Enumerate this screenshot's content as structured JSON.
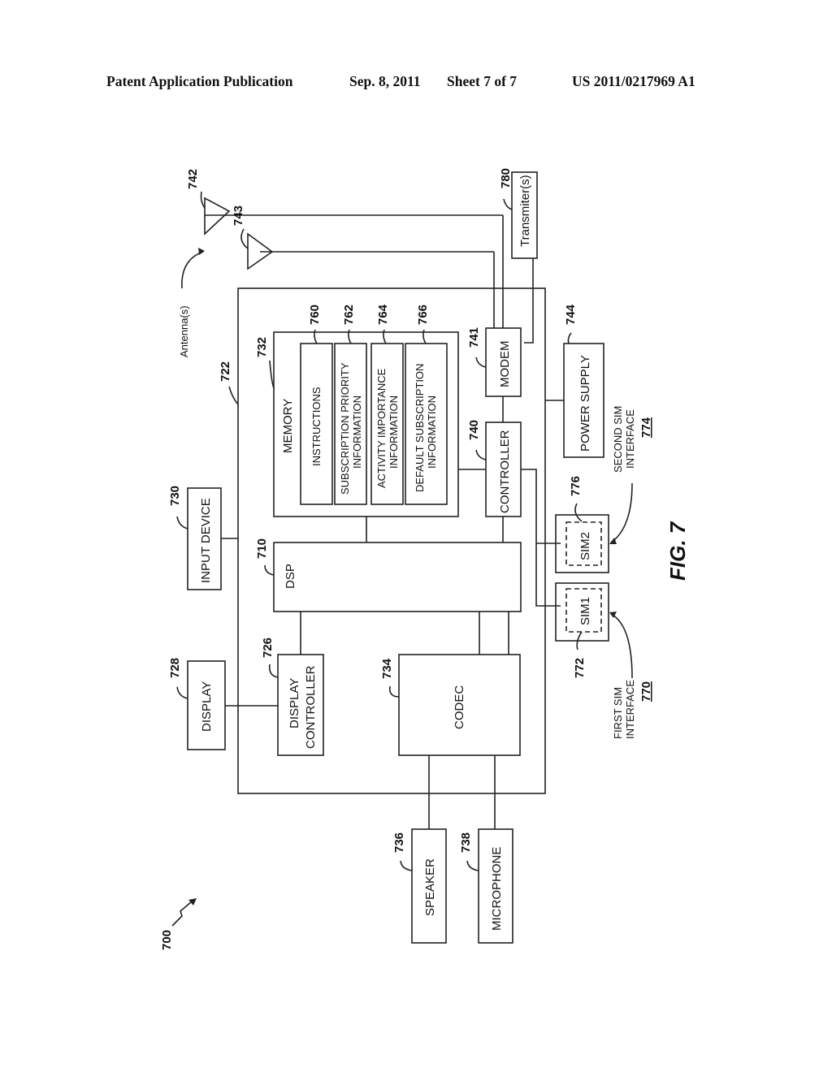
{
  "header": {
    "publication": "Patent Application Publication",
    "date": "Sep. 8, 2011",
    "sheet": "Sheet 7 of 7",
    "number": "US 2011/0217969 A1"
  },
  "figure": {
    "label": "FIG. 7",
    "system_ref": "700",
    "device_ref": "722"
  },
  "antennas": {
    "label": "Antenna(s)",
    "refs": [
      "742",
      "743"
    ]
  },
  "blocks": {
    "transmitter": {
      "label": "Transmiter(s)",
      "ref": "780"
    },
    "memory": {
      "label": "MEMORY",
      "ref": "732"
    },
    "instructions": {
      "label": "INSTRUCTIONS",
      "ref": "760"
    },
    "subscription_priority": {
      "line1": "SUBSCRIPTION PRIORITY",
      "line2": "INFORMATION",
      "ref": "762"
    },
    "activity_importance": {
      "line1": "ACTIVITY IMPORTANCE",
      "line2": "INFORMATION",
      "ref": "764"
    },
    "default_subscription": {
      "line1": "DEFAULT SUBSCRIPTION",
      "line2": "INFORMATION",
      "ref": "766"
    },
    "modem": {
      "label": "MODEM",
      "ref": "741"
    },
    "controller": {
      "label": "CONTROLLER",
      "ref": "740"
    },
    "power_supply": {
      "label": "POWER SUPPLY",
      "ref": "744"
    },
    "input_device": {
      "label": "INPUT DEVICE",
      "ref": "730"
    },
    "dsp": {
      "label": "DSP",
      "ref": "710"
    },
    "display": {
      "label": "DISPLAY",
      "ref": "728"
    },
    "display_controller": {
      "line1": "DISPLAY",
      "line2": "CONTROLLER",
      "ref": "726"
    },
    "codec": {
      "label": "CODEC",
      "ref": "734"
    },
    "speaker": {
      "label": "SPEAKER",
      "ref": "736"
    },
    "microphone": {
      "label": "MICROPHONE",
      "ref": "738"
    },
    "sim1": {
      "label": "SIM1",
      "ref": "772"
    },
    "sim2": {
      "label": "SIM2",
      "ref": "776"
    }
  },
  "interfaces": {
    "first_sim": {
      "line1": "FIRST SIM",
      "line2": "INTERFACE",
      "ref": "770"
    },
    "second_sim": {
      "line1": "SECOND SIM",
      "line2": "INTERFACE",
      "ref": "774"
    }
  }
}
